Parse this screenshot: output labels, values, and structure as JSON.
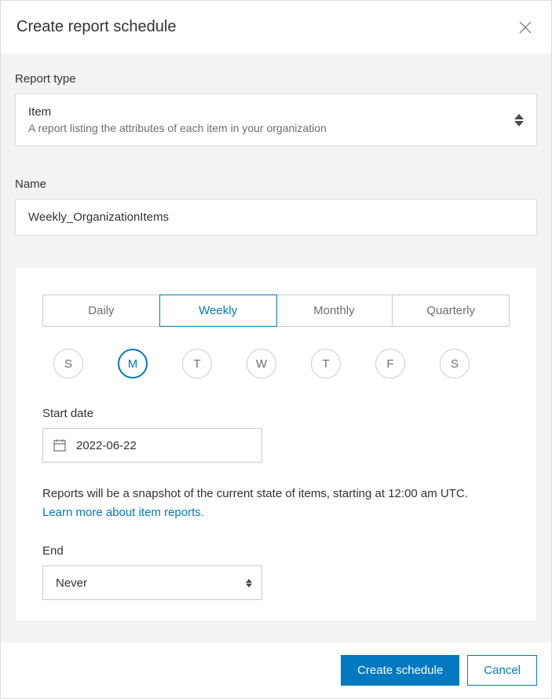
{
  "dialog": {
    "title": "Create report schedule"
  },
  "reportType": {
    "label": "Report type",
    "value": "Item",
    "description": "A report listing the attributes of each item in your organization"
  },
  "name": {
    "label": "Name",
    "value": "Weekly_OrganizationItems"
  },
  "frequency": {
    "tabs": {
      "daily": "Daily",
      "weekly": "Weekly",
      "monthly": "Monthly",
      "quarterly": "Quarterly"
    },
    "selected": "Weekly"
  },
  "days": {
    "d0": "S",
    "d1": "M",
    "d2": "T",
    "d3": "W",
    "d4": "T",
    "d5": "F",
    "d6": "S",
    "selected": "M"
  },
  "startDate": {
    "label": "Start date",
    "value": "2022-06-22"
  },
  "info": {
    "text": "Reports will be a snapshot of the current state of items, starting at 12:00 am UTC.",
    "link": "Learn more about item reports."
  },
  "end": {
    "label": "End",
    "value": "Never"
  },
  "footer": {
    "create": "Create schedule",
    "cancel": "Cancel"
  }
}
